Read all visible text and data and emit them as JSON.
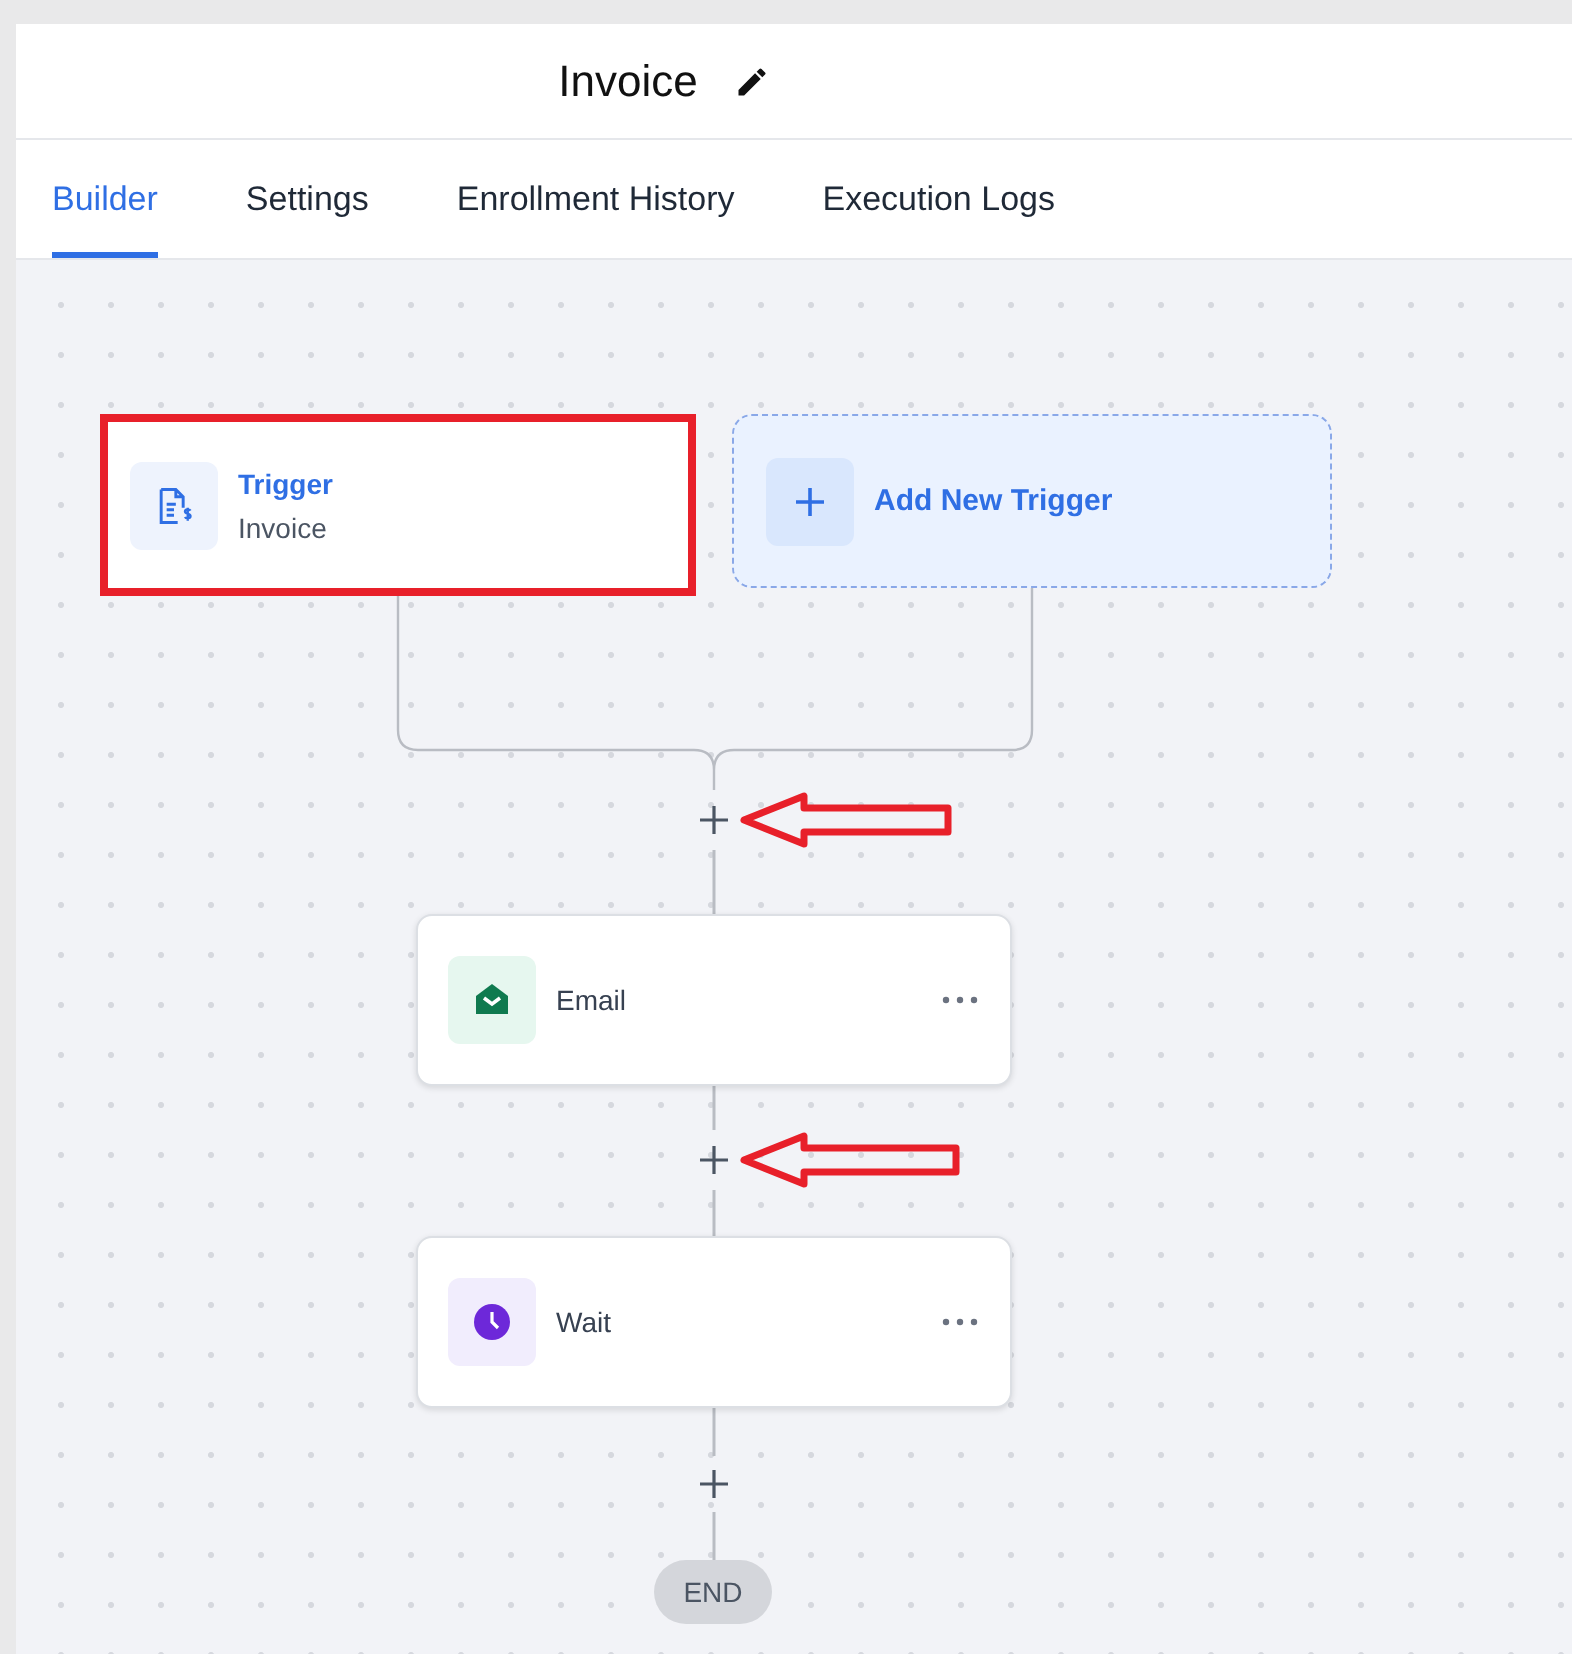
{
  "header": {
    "title": "Invoice"
  },
  "tabs": [
    {
      "label": "Builder",
      "selected": true
    },
    {
      "label": "Settings",
      "selected": false
    },
    {
      "label": "Enrollment History",
      "selected": false
    },
    {
      "label": "Execution Logs",
      "selected": false
    }
  ],
  "trigger": {
    "title": "Trigger",
    "subtitle": "Invoice",
    "highlighted": true
  },
  "add_trigger": {
    "label": "Add New Trigger"
  },
  "actions": [
    {
      "kind": "email",
      "label": "Email"
    },
    {
      "kind": "wait",
      "label": "Wait"
    }
  ],
  "end": {
    "label": "END"
  }
}
